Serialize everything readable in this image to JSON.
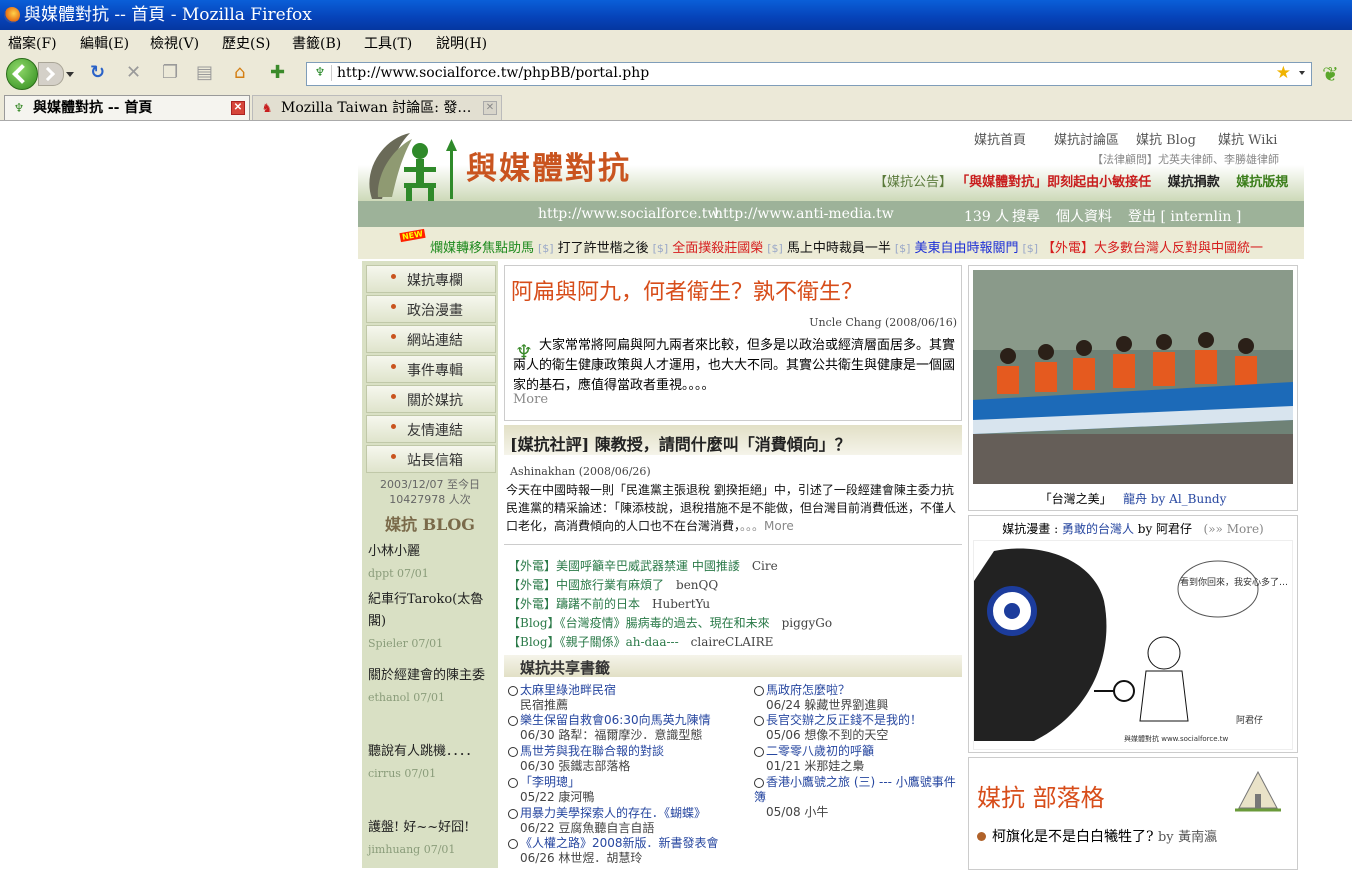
{
  "window": {
    "title": "與媒體對抗 -- 首頁 - Mozilla Firefox"
  },
  "menubar": [
    "檔案(F)",
    "編輯(E)",
    "檢視(V)",
    "歷史(S)",
    "書籤(B)",
    "工具(T)",
    "說明(H)"
  ],
  "toolbar": {
    "back_icon": "back-arrow-icon",
    "forward_icon": "forward-arrow-icon",
    "reload_icon": "reload-icon",
    "stop_icon": "stop-icon",
    "home_icon": "home-icon",
    "url": "http://www.socialforce.tw/phpBB/portal.php"
  },
  "tabs": [
    {
      "label": "與媒體對抗 -- 首頁",
      "active": true
    },
    {
      "label": "Mozilla Taiwan 討論區: 發…",
      "active": false
    }
  ],
  "site": {
    "brand": "與媒體對抗",
    "top_links": [
      "媒抗首頁",
      "媒抗討論區",
      "媒抗 Blog",
      "媒抗 Wiki"
    ],
    "lawyer": "【法律顧問】尤英夫律師、李勝雄律師",
    "notice_label": "【媒抗公告】",
    "notice_main": "「與媒體對抗」即刻起由小敏接任",
    "notice_donate": "媒抗捐款",
    "notice_rules": "媒抗版規",
    "urls": [
      "http://www.socialforce.tw",
      "http://www.anti-media.tw"
    ],
    "online": "139 人",
    "actions": [
      "搜尋",
      "個人資料",
      "登出 [ internlin ]"
    ],
    "ticker": [
      {
        "text": "爛媒轉移焦點助馬",
        "color": "#1e8a1e"
      },
      {
        "text": "打了許世楷之後",
        "color": "#111111"
      },
      {
        "text": "全面撲殺莊國榮",
        "color": "#d61d1d"
      },
      {
        "text": "馬上中時裁員一半",
        "color": "#111111"
      },
      {
        "text": "美東自由時報關門",
        "color": "#1d2fd6"
      },
      {
        "text": "【外電】大多數台灣人反對與中國統一",
        "color": "#d61d1d"
      }
    ],
    "ticker_sep": "[$]",
    "new_badge": "NEW"
  },
  "sidebar": {
    "items": [
      "媒抗專欄",
      "政治漫畫",
      "網站連結",
      "事件專輯",
      "關於媒抗",
      "友情連結",
      "站長信箱"
    ],
    "counter_line1": "2003/12/07 至今日",
    "counter_line2": "10427978 人次",
    "blog_head": "媒抗 BLOG",
    "blog_items": [
      {
        "title": "小林小麗",
        "meta": "dppt 07/01"
      },
      {
        "title": "紀車行Taroko(太魯閣)",
        "meta": "Spieler 07/01"
      },
      {
        "title": "關於經建會的陳主委",
        "meta": "ethanol 07/01"
      },
      {
        "title": "聽說有人跳機．．．．",
        "meta": "cirrus 07/01"
      },
      {
        "title": "護盤! 好~~好囧!",
        "meta": "jimhuang 07/01"
      }
    ]
  },
  "article1": {
    "title": "阿扁與阿九，何者衛生？孰不衛生？",
    "byline": "Uncle Chang (2008/06/16)",
    "body": "大家常常將阿扁與阿九兩者來比較，但多是以政治或經濟層面居多。其實兩人的衛生健康政策與人才運用，也大大不同。其實公共衛生與健康是一個國家的基石，應值得當政者重視。。。。",
    "more": "More"
  },
  "article2": {
    "title": "[媒抗社評] 陳教授，請問什麼叫「消費傾向」？",
    "byline": "Ashinakhan (2008/06/26)",
    "body": "今天在中國時報一則「民進黨主張退稅 劉揆拒絕」中，引述了一段經建會陳主委力抗民進黨的精采論述：「陳添枝說，退稅措施不是不能做，但台灣目前消費低迷，不僅人口老化，高消費傾向的人口也不在台灣消費，",
    "more": "。。。More"
  },
  "news": [
    {
      "title": "【外電】美國呼籲辛巴威武器禁運 中國推諉",
      "author": "Cire"
    },
    {
      "title": "【外電】中國旅行業有麻煩了",
      "author": "benQQ"
    },
    {
      "title": "【外電】躊躇不前的日本",
      "author": "HubertYu"
    },
    {
      "title": "【Blog】《台灣疫情》腸病毒的過去、現在和未來",
      "author": "piggyGo"
    },
    {
      "title": "【Blog】《親子關係》ah-daa---",
      "author": "claireCLAIRE"
    }
  ],
  "share": {
    "head": "媒抗共享書籤",
    "left": [
      {
        "title": "太麻里綠池畔民宿",
        "meta": "民宿推薦"
      },
      {
        "title": "樂生保留自救會06:30向馬英九陳情",
        "meta": "06/30 路犁：福爾摩沙．意識型態"
      },
      {
        "title": "馬世芳與我在聯合報的對談",
        "meta": "06/30 張鐵志部落格"
      },
      {
        "title": "「李明璁」",
        "meta": "05/22 康河鴨"
      },
      {
        "title": "用暴力美學探索人的存在．《蝴蝶》",
        "meta": "06/22 豆腐魚聽自言自語"
      },
      {
        "title": "《人權之路》2008新版．新書發表會",
        "meta": "06/26 林世煜．胡慧玲"
      }
    ],
    "right": [
      {
        "title": "馬政府怎麼啦？",
        "meta": "06/24 躲藏世界劉進興"
      },
      {
        "title": "長官交辦之反正錢不是我的！",
        "meta": "05/06 想像不到的天空"
      },
      {
        "title": "二零零八歲初的呼籲",
        "meta": "01/21 米那娃之梟"
      },
      {
        "title": "香港小鷹號之旅 (三) --- 小鷹號事件簿",
        "meta": "05/08 小牛"
      }
    ]
  },
  "photo": {
    "caption1": "「台灣之美」",
    "caption2": "龍舟 by Al_Bundy"
  },
  "comic": {
    "prefix": "媒抗漫畫 : ",
    "link": "勇敢的台灣人",
    "by": " by 阿君仔",
    "more": "(»» More)",
    "speech": "看到你回來，我安心多了…",
    "signature": "阿君仔",
    "footer": "與媒體對抗 www.socialforce.tw"
  },
  "blogbox": {
    "head": "媒抗 部落格",
    "item": "柯旗化是不是白白犧牲了?",
    "by": "by",
    "author": "黃南瀛"
  }
}
